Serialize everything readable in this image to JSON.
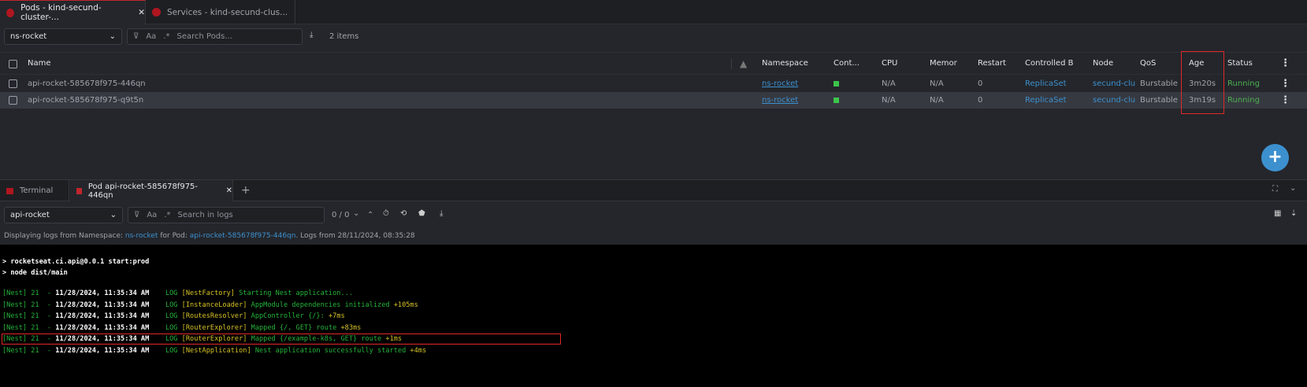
{
  "tabs": [
    {
      "label": "Pods - kind-secund-cluster-...",
      "active": true
    },
    {
      "label": "Services - kind-secund-clus..."
    }
  ],
  "toolbar": {
    "namespace": "ns-rocket",
    "search_placeholder": "Search Pods...",
    "case_label": "Aa",
    "regex_label": ".*",
    "items_count": "2 items"
  },
  "table": {
    "headers": [
      "Name",
      "Namespace",
      "Cont...",
      "CPU",
      "Memor",
      "Restart",
      "Controlled B",
      "Node",
      "QoS",
      "Age",
      "Status"
    ],
    "rows": [
      {
        "name": "api-rocket-585678f975-446qn",
        "namespace": "ns-rocket",
        "cpu": "N/A",
        "memory": "N/A",
        "restarts": "0",
        "controlled_by": "ReplicaSet",
        "node": "secund-clu",
        "qos": "Burstable",
        "age": "3m20s",
        "status": "Running"
      },
      {
        "name": "api-rocket-585678f975-q9t5n",
        "namespace": "ns-rocket",
        "cpu": "N/A",
        "memory": "N/A",
        "restarts": "0",
        "controlled_by": "ReplicaSet",
        "node": "secund-clu",
        "qos": "Burstable",
        "age": "3m19s",
        "status": "Running"
      }
    ]
  },
  "colors": {
    "accent": "#3d90ce",
    "running": "#4caf50",
    "container": "#3ec44a",
    "highlight": "#e02828"
  },
  "dock": {
    "tabs": [
      {
        "label": "Terminal"
      },
      {
        "label": "Pod api-rocket-585678f975-446qn"
      }
    ],
    "container": "api-rocket",
    "search_placeholder": "Search in logs",
    "match_count": "0 / 0",
    "info": {
      "prefix": "Displaying logs from Namespace:",
      "namespace": "ns-rocket",
      "mid": "for Pod:",
      "pod": "api-rocket-585678f975-446qn",
      "suffix": ". Logs from 28/11/2024, 08:35:28"
    }
  },
  "logs": {
    "cmd": [
      "> rocketseat.ci.api@0.0.1 start:prod",
      "> node dist/main"
    ],
    "lines": [
      {
        "pre": "[Nest] 21  - ",
        "ts": "11/28/2024, 11:35:34 AM",
        "lvl": "    LOG ",
        "ctx": "[NestFactory] ",
        "msg": "Starting Nest application...",
        "extra": ""
      },
      {
        "pre": "[Nest] 21  - ",
        "ts": "11/28/2024, 11:35:34 AM",
        "lvl": "    LOG ",
        "ctx": "[InstanceLoader] ",
        "msg": "AppModule dependencies initialized ",
        "extra": "+105ms"
      },
      {
        "pre": "[Nest] 21  - ",
        "ts": "11/28/2024, 11:35:34 AM",
        "lvl": "    LOG ",
        "ctx": "[RoutesResolver] ",
        "msg": "AppController {/}: ",
        "extra": "+7ms"
      },
      {
        "pre": "[Nest] 21  - ",
        "ts": "11/28/2024, 11:35:34 AM",
        "lvl": "    LOG ",
        "ctx": "[RouterExplorer] ",
        "msg": "Mapped {/, GET} route ",
        "extra": "+83ms"
      },
      {
        "pre": "[Nest] 21  - ",
        "ts": "11/28/2024, 11:35:34 AM",
        "lvl": "    LOG ",
        "ctx": "[RouterExplorer] ",
        "msg": "Mapped {/example-k8s, GET} route ",
        "extra": "+1ms"
      },
      {
        "pre": "[Nest] 21  - ",
        "ts": "11/28/2024, 11:35:34 AM",
        "lvl": "    LOG ",
        "ctx": "[NestApplication] ",
        "msg": "Nest application successfully started ",
        "extra": "+4ms"
      }
    ]
  }
}
